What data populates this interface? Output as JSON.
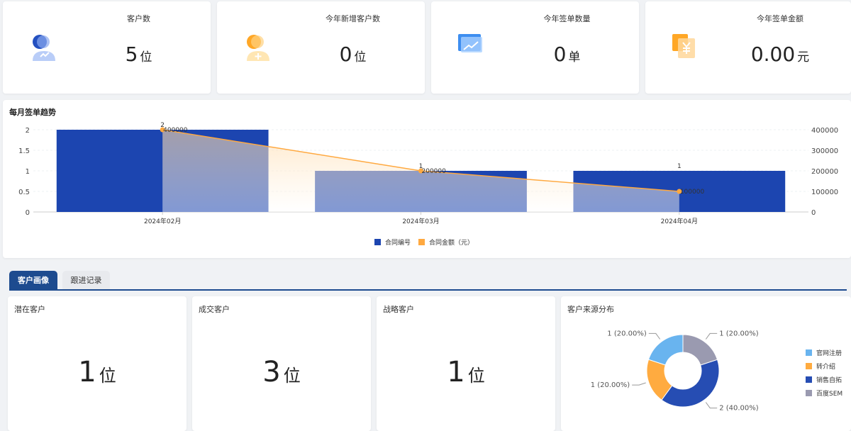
{
  "stats": [
    {
      "label": "客户数",
      "value": "5",
      "unit": "位",
      "icon": "user-trend-icon"
    },
    {
      "label": "今年新增客户数",
      "value": "0",
      "unit": "位",
      "icon": "user-add-icon"
    },
    {
      "label": "今年签单数量",
      "value": "0",
      "unit": "单",
      "icon": "chart-screen-icon"
    },
    {
      "label": "今年签单金额",
      "value": "0.00",
      "unit": "元",
      "icon": "yuan-doc-icon"
    }
  ],
  "chart_data": {
    "type": "bar",
    "title": "每月签单趋势",
    "categories": [
      "2024年02月",
      "2024年03月",
      "2024年04月"
    ],
    "series": [
      {
        "name": "合同编号",
        "type": "bar",
        "axis": "left",
        "values": [
          2,
          1,
          1
        ],
        "color": "#1c45b0"
      },
      {
        "name": "合同金额（元）",
        "type": "line",
        "axis": "right",
        "values": [
          400000,
          200000,
          100000
        ],
        "color": "#ffa940"
      }
    ],
    "ylim_left": [
      0,
      2
    ],
    "yticks_left": [
      "0",
      "0.5",
      "1",
      "1.5",
      "2"
    ],
    "ylim_right": [
      0,
      400000
    ],
    "yticks_right": [
      "0",
      "100000",
      "200000",
      "300000",
      "400000"
    ],
    "legend": "bottom-center"
  },
  "tabs": [
    {
      "label": "客户画像",
      "active": true
    },
    {
      "label": "跟进记录",
      "active": false
    }
  ],
  "customers": [
    {
      "label": "潜在客户",
      "value": "1",
      "unit": "位"
    },
    {
      "label": "成交客户",
      "value": "3",
      "unit": "位"
    },
    {
      "label": "战略客户",
      "value": "1",
      "unit": "位"
    }
  ],
  "source": {
    "title": "客户来源分布",
    "items": [
      {
        "name": "官网注册",
        "value": 1,
        "label": "1 (20.00%)",
        "color": "#69b4ef"
      },
      {
        "name": "转介绍",
        "value": 1,
        "label": "1 (20.00%)",
        "color": "#ffab40"
      },
      {
        "name": "销售自拓",
        "value": 2,
        "label": "2 (40.00%)",
        "color": "#264db3"
      },
      {
        "name": "百度SEM",
        "value": 1,
        "label": "1 (20.00%)",
        "color": "#9a9ab0"
      }
    ]
  }
}
